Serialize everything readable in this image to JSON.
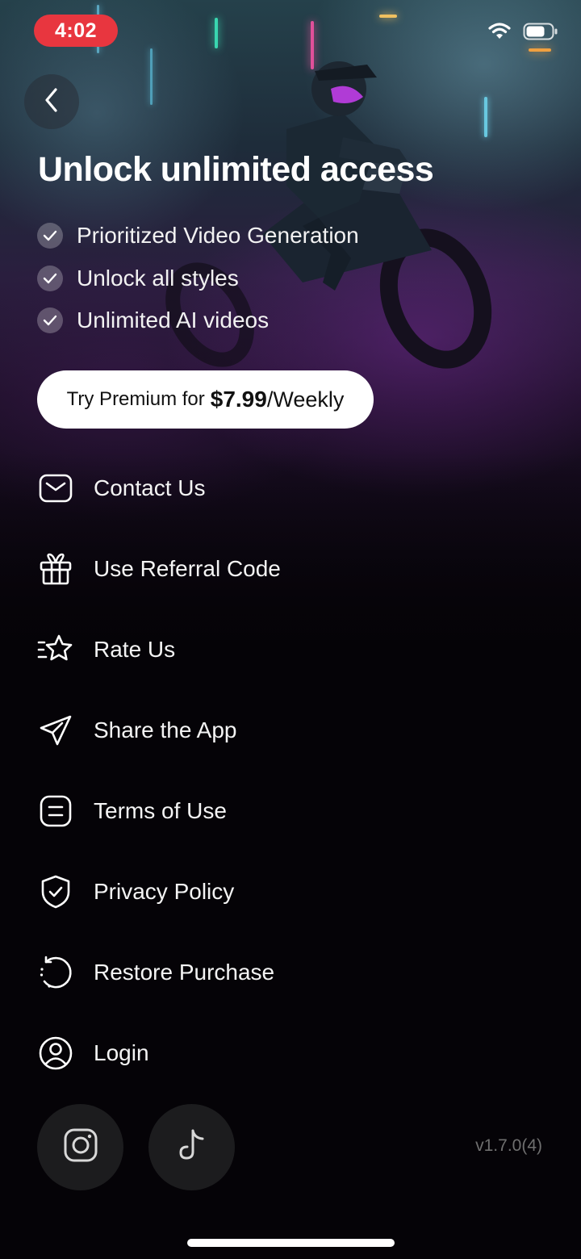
{
  "status_bar": {
    "time": "4:02",
    "icons": [
      "wifi-icon",
      "battery-icon"
    ]
  },
  "header": {
    "back_icon": "chevron-left-icon",
    "title": "Unlock unlimited access"
  },
  "features": [
    {
      "icon": "check-circle-icon",
      "label": "Prioritized Video Generation"
    },
    {
      "icon": "check-circle-icon",
      "label": "Unlock all styles"
    },
    {
      "icon": "check-circle-icon",
      "label": "Unlimited AI videos"
    }
  ],
  "premium": {
    "prefix": "Try Premium for",
    "price": "$7.99",
    "period": "/Weekly"
  },
  "menu": [
    {
      "icon": "mail-icon",
      "label": "Contact Us"
    },
    {
      "icon": "gift-icon",
      "label": "Use Referral Code"
    },
    {
      "icon": "star-icon",
      "label": "Rate Us"
    },
    {
      "icon": "send-icon",
      "label": "Share the App"
    },
    {
      "icon": "document-icon",
      "label": "Terms of Use"
    },
    {
      "icon": "shield-check-icon",
      "label": "Privacy Policy"
    },
    {
      "icon": "restore-icon",
      "label": "Restore Purchase"
    },
    {
      "icon": "user-circle-icon",
      "label": "Login"
    }
  ],
  "social": [
    {
      "icon": "instagram-icon"
    },
    {
      "icon": "tiktok-icon"
    }
  ],
  "version": "v1.7.0(4)",
  "colors": {
    "background": "#050307",
    "time_pill": "#e8363f",
    "accent_purple": "#6e288c",
    "button_bg": "#ffffff",
    "social_bg": "#1c1c1e",
    "version_text": "#6f6f6f"
  }
}
